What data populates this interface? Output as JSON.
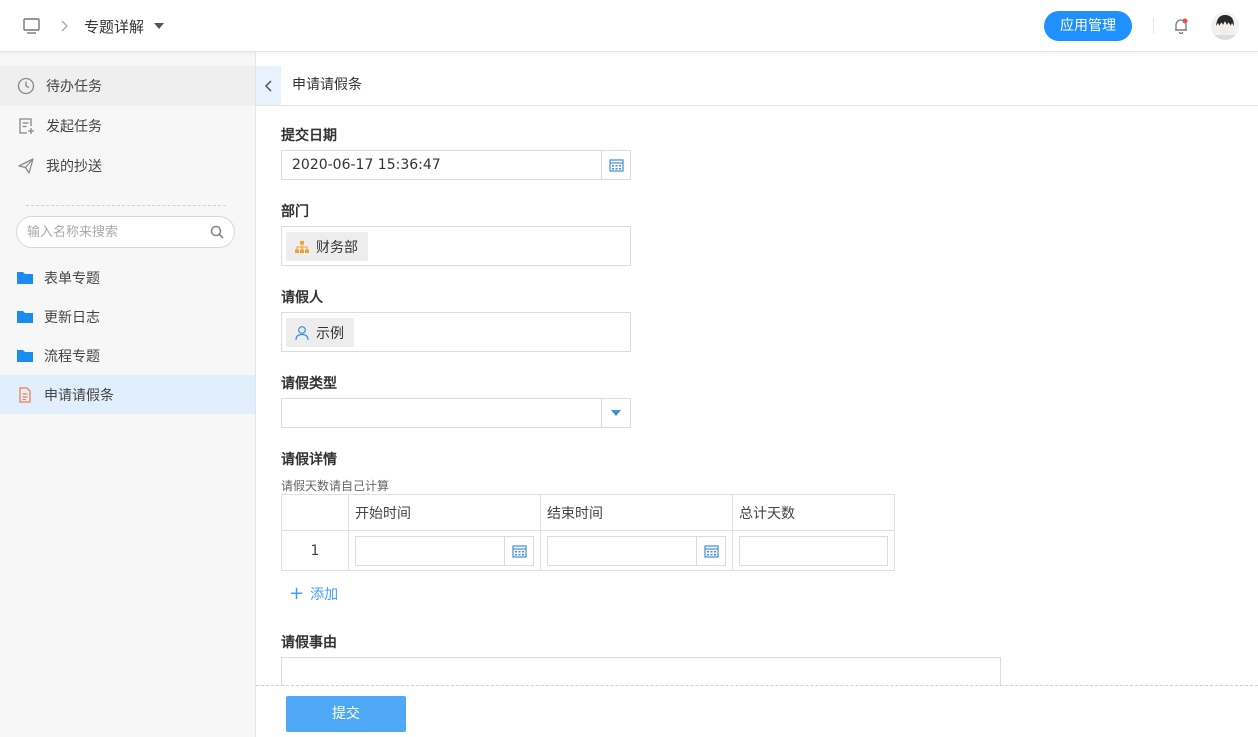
{
  "header": {
    "breadcrumb_title": "专题详解",
    "app_manage_label": "应用管理"
  },
  "sidebar": {
    "nav": [
      {
        "label": "待办任务",
        "icon": "clock-icon"
      },
      {
        "label": "发起任务",
        "icon": "new-task-icon"
      },
      {
        "label": "我的抄送",
        "icon": "paper-plane-icon"
      }
    ],
    "search_placeholder": "输入名称来搜索",
    "folders": [
      {
        "label": "表单专题",
        "icon": "folder-icon"
      },
      {
        "label": "更新日志",
        "icon": "folder-icon"
      },
      {
        "label": "流程专题",
        "icon": "folder-icon"
      },
      {
        "label": "申请请假条",
        "icon": "document-icon"
      }
    ]
  },
  "main": {
    "tab_title": "申请请假条",
    "form": {
      "submit_date": {
        "label": "提交日期",
        "value": "2020-06-17 15:36:47"
      },
      "department": {
        "label": "部门",
        "tag": "财务部"
      },
      "applicant": {
        "label": "请假人",
        "tag": "示例"
      },
      "leave_type": {
        "label": "请假类型",
        "value": ""
      },
      "details": {
        "label": "请假详情",
        "hint": "请假天数请自己计算",
        "columns": [
          "开始时间",
          "结束时间",
          "总计天数"
        ],
        "rows": [
          {
            "index": "1",
            "start": "",
            "end": "",
            "days": ""
          }
        ],
        "add_label": "添加"
      },
      "reason": {
        "label": "请假事由",
        "value": ""
      }
    },
    "submit_label": "提交"
  },
  "colors": {
    "accent": "#1e90ff",
    "folder": "#1a8cf0",
    "document": "#f07d4a",
    "submit": "#4fa8f5"
  }
}
